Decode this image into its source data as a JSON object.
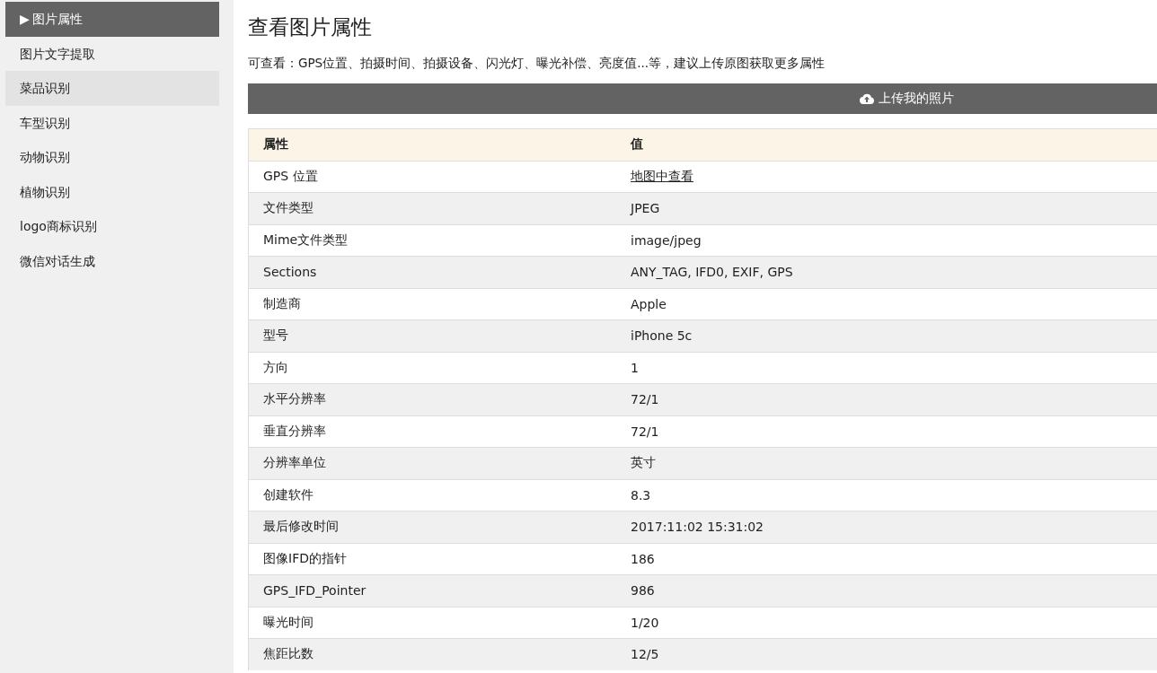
{
  "sidebar": {
    "items": [
      {
        "label": "图片属性",
        "marker": "▶",
        "selected": true,
        "hovered": false
      },
      {
        "label": "图片文字提取",
        "selected": false,
        "hovered": false
      },
      {
        "label": "菜品识别",
        "selected": false,
        "hovered": true
      },
      {
        "label": "车型识别",
        "selected": false,
        "hovered": false
      },
      {
        "label": "动物识别",
        "selected": false,
        "hovered": false
      },
      {
        "label": "植物识别",
        "selected": false,
        "hovered": false
      },
      {
        "label": "logo商标识别",
        "selected": false,
        "hovered": false
      },
      {
        "label": "微信对话生成",
        "selected": false,
        "hovered": false
      }
    ]
  },
  "page": {
    "title": "查看图片属性",
    "description": "可查看：GPS位置、拍摄时间、拍摄设备、闪光灯、曝光补偿、亮度值...等，建议上传原图获取更多属性",
    "upload_button": "上传我的照片"
  },
  "table": {
    "columns": [
      "属性",
      "值"
    ],
    "rows": [
      {
        "name": "GPS 位置",
        "value": "地图中查看",
        "kind": "link"
      },
      {
        "name": "文件类型",
        "value": "JPEG",
        "kind": "text"
      },
      {
        "name": "Mime文件类型",
        "value": "image/jpeg",
        "kind": "text"
      },
      {
        "name": "Sections",
        "value": "ANY_TAG, IFD0, EXIF, GPS",
        "kind": "text"
      },
      {
        "name": "制造商",
        "value": "Apple",
        "kind": "text"
      },
      {
        "name": "型号",
        "value": "iPhone 5c",
        "kind": "text"
      },
      {
        "name": "方向",
        "value": "1",
        "kind": "text"
      },
      {
        "name": "水平分辨率",
        "value": "72/1",
        "kind": "text"
      },
      {
        "name": "垂直分辨率",
        "value": "72/1",
        "kind": "text"
      },
      {
        "name": "分辨率单位",
        "value": "英寸",
        "kind": "text"
      },
      {
        "name": "创建软件",
        "value": "8.3",
        "kind": "text"
      },
      {
        "name": "最后修改时间",
        "value": "2017:11:02 15:31:02",
        "kind": "text"
      },
      {
        "name": "图像IFD的指针",
        "value": "186",
        "kind": "text"
      },
      {
        "name": "GPS_IFD_Pointer",
        "value": "986",
        "kind": "text"
      },
      {
        "name": "曝光时间",
        "value": "1/20",
        "kind": "text"
      },
      {
        "name": "焦距比数",
        "value": "12/5",
        "kind": "text"
      }
    ]
  }
}
